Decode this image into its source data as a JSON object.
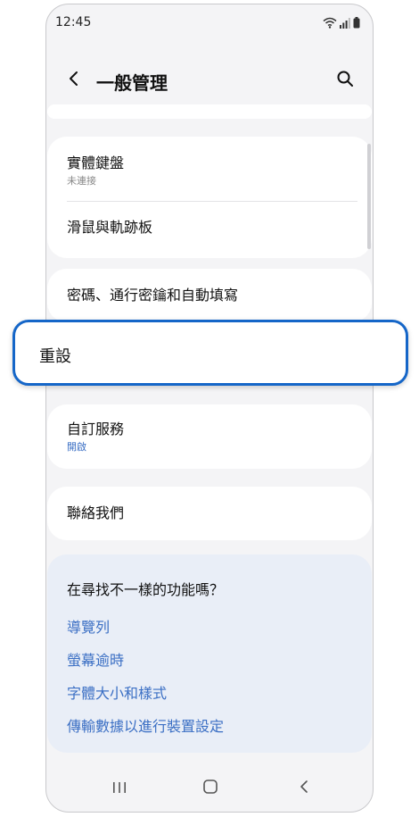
{
  "status_bar": {
    "time": "12:45"
  },
  "app_bar": {
    "title": "一般管理"
  },
  "settings": {
    "physical_keyboard": {
      "label": "實體鍵盤",
      "status": "未連接"
    },
    "mouse_trackpad": {
      "label": "滑鼠與軌跡板"
    },
    "passwords": {
      "label": "密碼、通行密鑰和自動填寫"
    },
    "reset": {
      "label": "重設"
    },
    "customization_service": {
      "label": "自訂服務",
      "status": "開啟"
    },
    "contact_us": {
      "label": "聯絡我們"
    }
  },
  "suggestions": {
    "title": "在尋找不一樣的功能嗎？",
    "links": [
      "導覽列",
      "螢幕逾時",
      "字體大小和樣式",
      "傳輸數據以進行裝置設定"
    ]
  },
  "colors": {
    "accent": "#3b6fc4",
    "highlight_border": "#1566c8",
    "background": "#f4f4f6",
    "card": "#ffffff",
    "suggest_card": "#e9eef7"
  }
}
